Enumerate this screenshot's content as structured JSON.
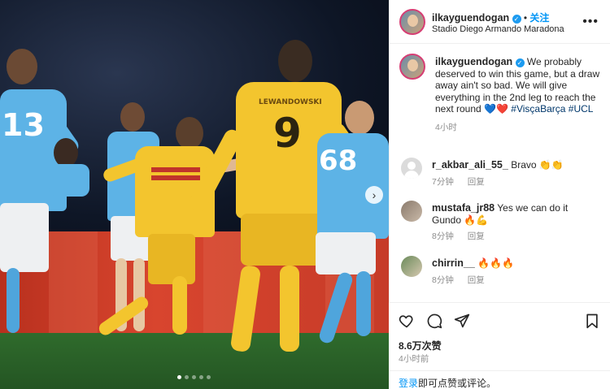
{
  "post": {
    "username": "ilkayguendogan",
    "follow_label": "关注",
    "location": "Stadio Diego Armando Maradona",
    "caption": "We probably deserved to win this game, but a draw away ain't so bad. We will give everything in the 2nd leg to reach the next round",
    "caption_emojis": "💙❤️",
    "hashtag1": "#VisçaBarça",
    "hashtag2": "#UCL",
    "caption_time": "4小时",
    "likes": "8.6万次赞",
    "post_time": "4小时前"
  },
  "comments": [
    {
      "username": "r_akbar_ali_55_",
      "text": "Bravo 👏👏",
      "time": "7分钟",
      "reply": "回复"
    },
    {
      "username": "mustafa_jr88",
      "text": "Yes we can do it Gundo 🔥💪",
      "time": "8分钟",
      "reply": "回复"
    },
    {
      "username": "chirrin__",
      "text": "🔥🔥🔥",
      "time": "8分钟",
      "reply": "回复"
    }
  ],
  "login": {
    "link": "登录",
    "rest": "即可点赞或评论。"
  },
  "photo": {
    "jersey_left": "13",
    "jersey_center": "9",
    "jersey_name_center": "LEWANDOWSKI",
    "jersey_right": "68",
    "carousel_index": 1,
    "carousel_count": 5
  },
  "icons": [
    "heart-icon",
    "comment-icon",
    "share-icon",
    "bookmark-icon",
    "more-icon",
    "verified-icon",
    "chevron-right-icon"
  ],
  "colors": {
    "accent": "#0095f6",
    "napoli_sky": "#5db3e6",
    "barca_yellow": "#f3c52e"
  }
}
